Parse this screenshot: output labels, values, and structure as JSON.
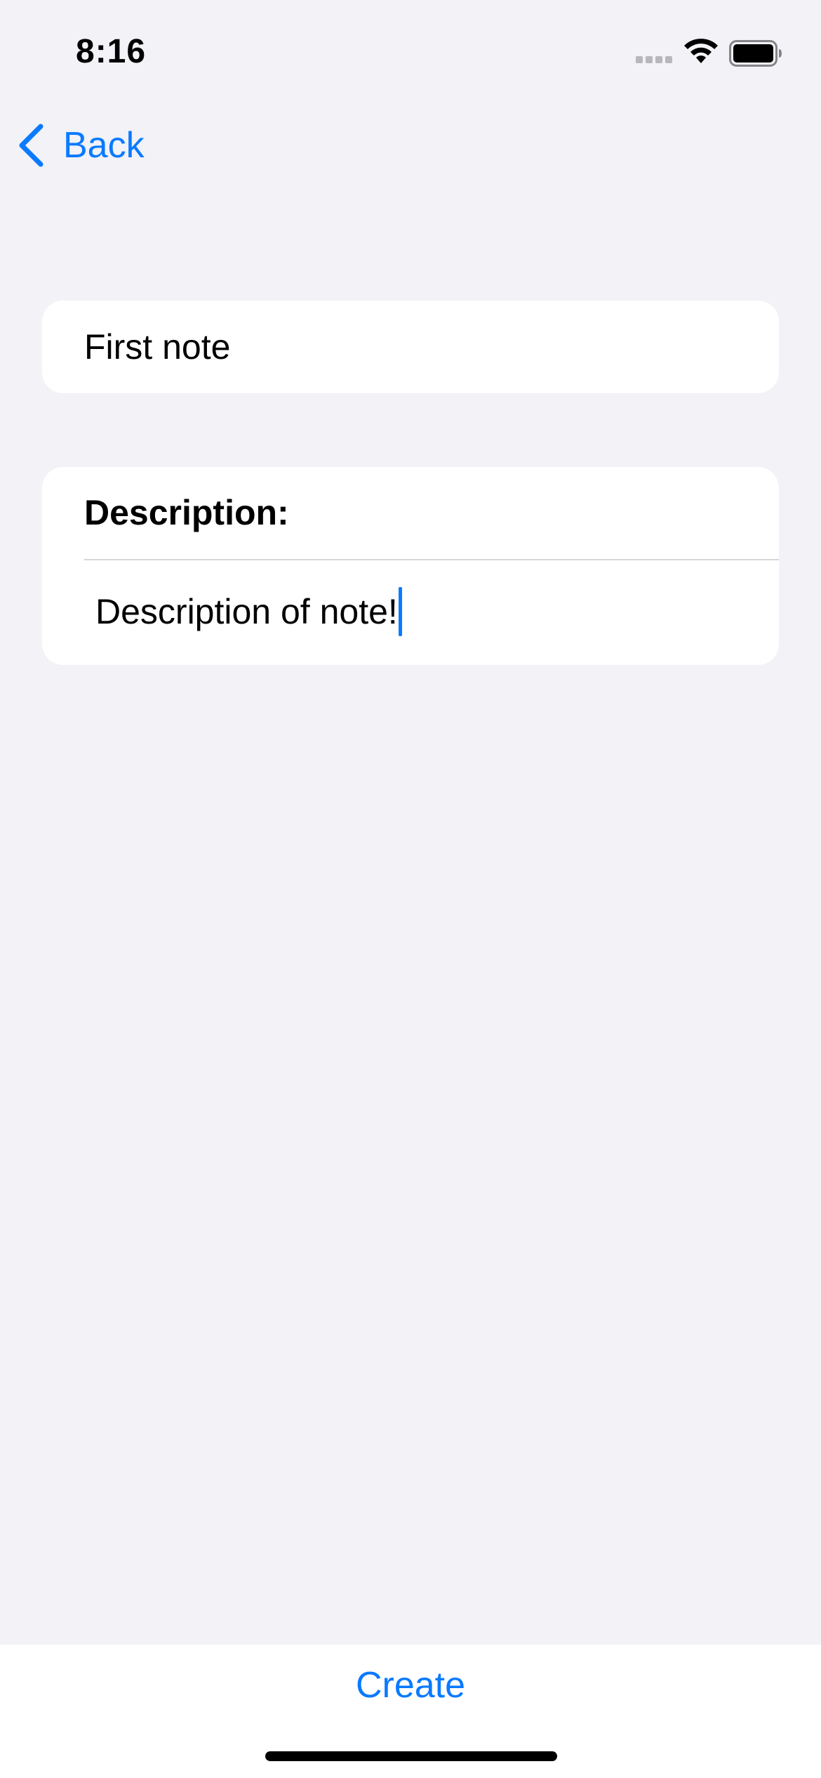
{
  "status_bar": {
    "time": "8:16",
    "icons": [
      "cellular-signal-icon",
      "wifi-icon",
      "battery-icon"
    ]
  },
  "nav": {
    "back_label": "Back"
  },
  "form": {
    "title_value": "First note",
    "description_header": "Description:",
    "description_value": "Description of note!"
  },
  "bottom": {
    "create_label": "Create"
  },
  "colors": {
    "accent": "#0a7aff",
    "background": "#f2f2f7",
    "card": "#ffffff"
  }
}
